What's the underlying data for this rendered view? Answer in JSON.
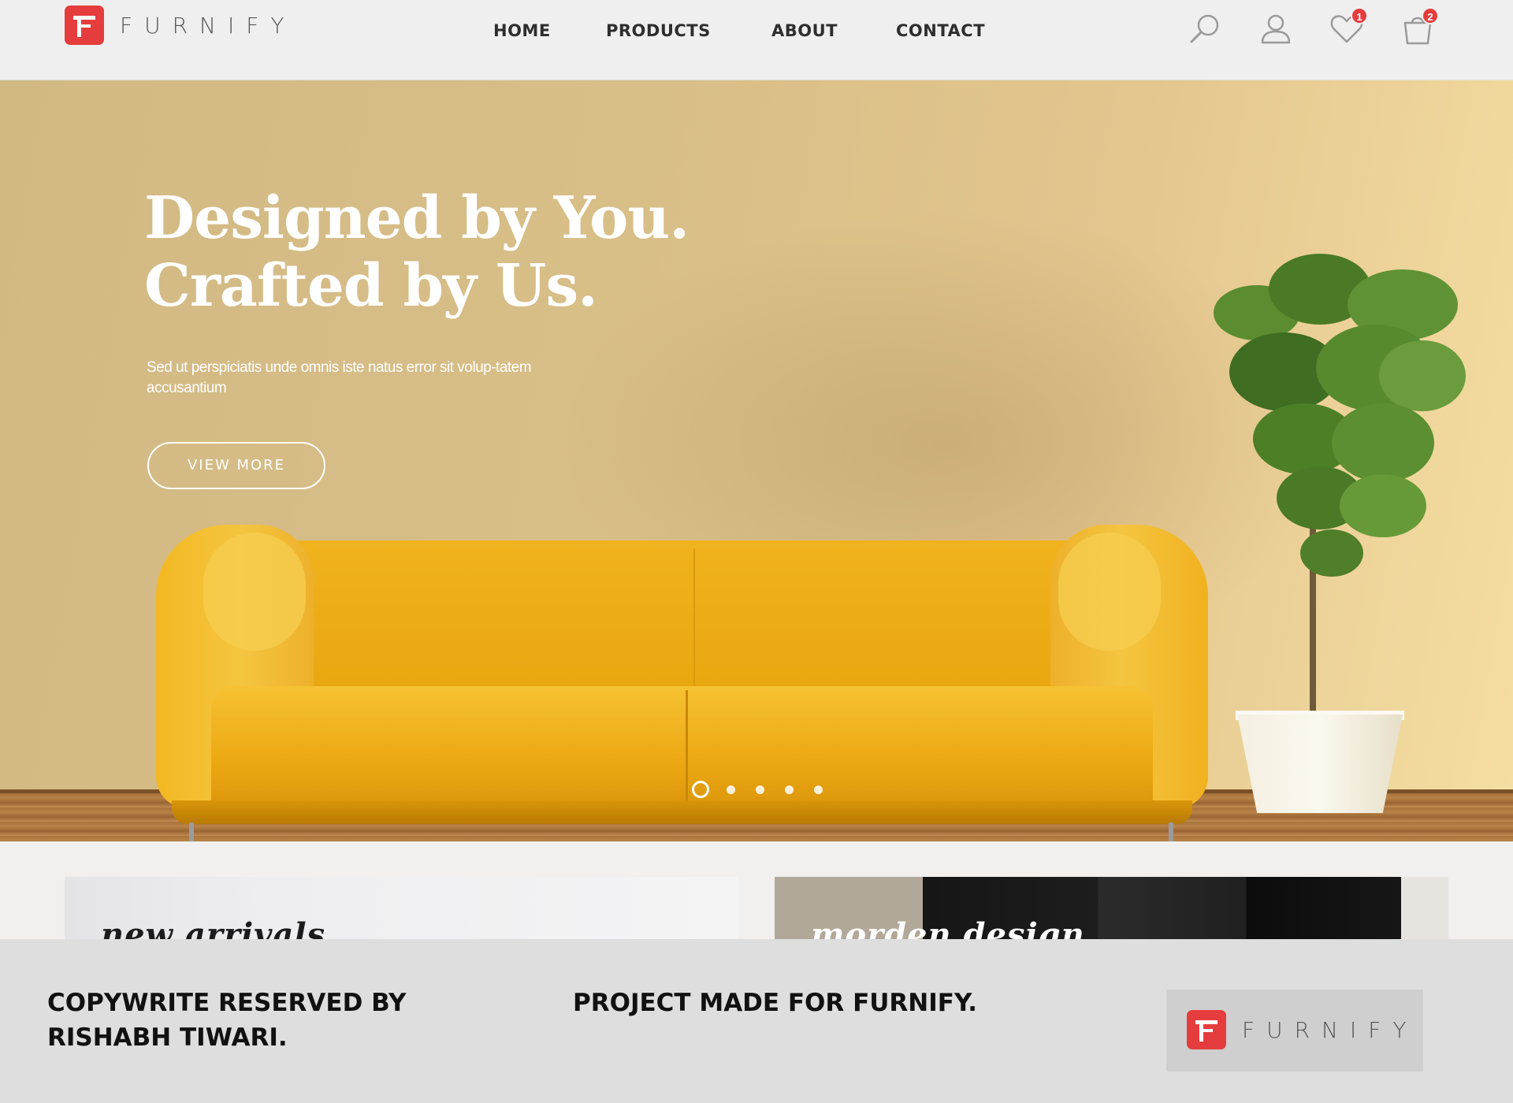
{
  "brand": {
    "name": "FURNIFY",
    "accent_color": "#e53d3d"
  },
  "nav": {
    "items": [
      {
        "label": "HOME"
      },
      {
        "label": "PRODUCTS"
      },
      {
        "label": "ABOUT"
      },
      {
        "label": "CONTACT"
      }
    ]
  },
  "header_icons": {
    "search": {
      "icon": "search-icon"
    },
    "account": {
      "icon": "user-icon"
    },
    "wishlist": {
      "icon": "heart-icon",
      "count": "1"
    },
    "cart": {
      "icon": "shopping-bag-icon",
      "count": "2"
    }
  },
  "hero": {
    "title_line1": "Designed by You.",
    "title_line2": "Crafted by Us.",
    "subtitle": "Sed ut perspiciatis unde omnis iste natus error sit volup-tatem accusantium",
    "cta_label": "VIEW MORE",
    "slides_total": 5,
    "active_slide": 1
  },
  "categories": [
    {
      "title": "new arrivals"
    },
    {
      "title": "morden design"
    }
  ],
  "footer": {
    "credit": "COPYWRITE RESERVED BY RISHABH TIWARI.",
    "project_note": "PROJECT MADE FOR FURNIFY.",
    "logo_text": "FURNIFY"
  }
}
